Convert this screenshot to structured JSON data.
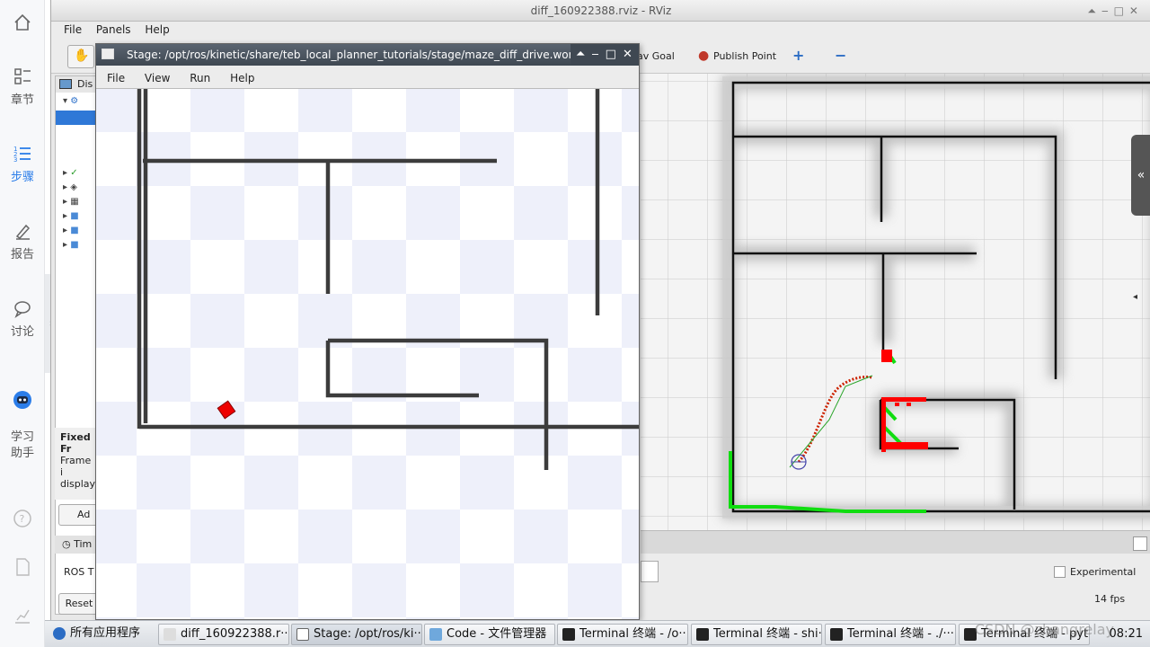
{
  "sidebar": {
    "items": [
      {
        "label": "章节",
        "icon": "list-icon"
      },
      {
        "label": "步骤",
        "icon": "steps-icon"
      },
      {
        "label": "报告",
        "icon": "pencil-icon"
      },
      {
        "label": "讨论",
        "icon": "chat-icon"
      },
      {
        "label": "学习\n助手",
        "icon": "robot-icon"
      }
    ]
  },
  "rviz": {
    "title": "diff_160922388.rviz - RViz",
    "menu": [
      "File",
      "Panels",
      "Help"
    ],
    "toolbar": {
      "nav_goal": "av Goal",
      "publish_point": "Publish Point"
    },
    "panel_header": "Dis",
    "fixed_frame": {
      "title": "Fixed Fr",
      "line1": "Frame i",
      "line2": "displaye"
    },
    "add_button": "Ad",
    "time_header": "Tim",
    "ros_time": "ROS T",
    "reset_button": "Reset",
    "experimental_label": "Experimental",
    "fps": "14 fps"
  },
  "stage": {
    "title": "Stage: /opt/ros/kinetic/share/teb_local_planner_tutorials/stage/maze_diff_drive.worl",
    "menu": [
      "File",
      "View",
      "Run",
      "Help"
    ]
  },
  "taskbar": {
    "start": "所有应用程序",
    "tasks": [
      "diff_160922388.r···",
      "Stage: /opt/ros/ki···",
      "Code - 文件管理器",
      "Terminal 终端 - /o···",
      "Terminal 终端 - shi···",
      "Terminal 终端 - ./···",
      "Terminal 终端 - pyt···"
    ],
    "clock": "08:21",
    "watermark": "CSDN @zhangrelay"
  },
  "colors": {
    "accent": "#2b7de9",
    "selection": "#2f78d7",
    "robot": "#ff0000",
    "scan": "#00dd00"
  }
}
